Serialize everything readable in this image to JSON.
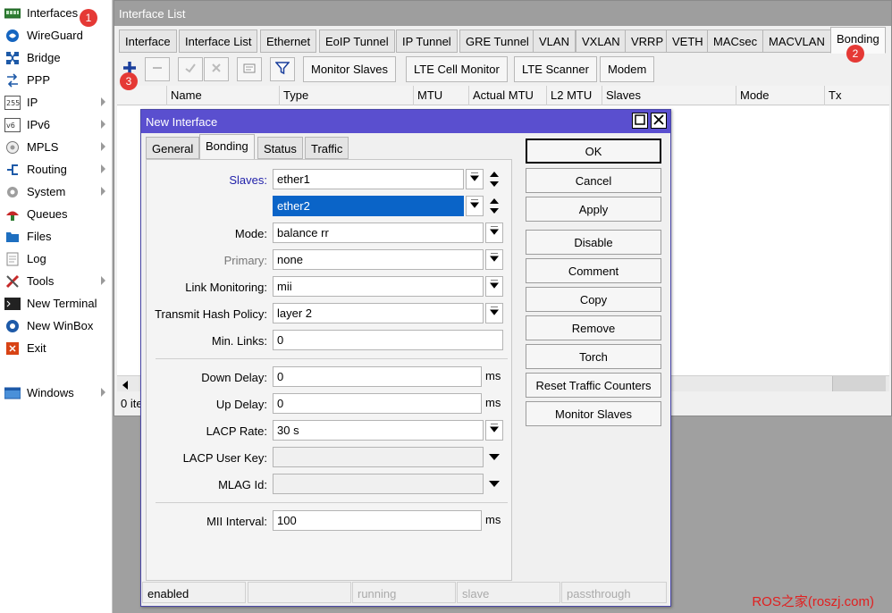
{
  "sidebar": {
    "items": [
      {
        "label": "Interfaces",
        "icon": "interfaces-icon",
        "submenu": false
      },
      {
        "label": "WireGuard",
        "icon": "wireguard-icon",
        "submenu": false
      },
      {
        "label": "Bridge",
        "icon": "bridge-icon",
        "submenu": false
      },
      {
        "label": "PPP",
        "icon": "ppp-icon",
        "submenu": false
      },
      {
        "label": "IP",
        "icon": "ip-icon",
        "submenu": true
      },
      {
        "label": "IPv6",
        "icon": "ipv6-icon",
        "submenu": true
      },
      {
        "label": "MPLS",
        "icon": "mpls-icon",
        "submenu": true
      },
      {
        "label": "Routing",
        "icon": "routing-icon",
        "submenu": true
      },
      {
        "label": "System",
        "icon": "system-icon",
        "submenu": true
      },
      {
        "label": "Queues",
        "icon": "queues-icon",
        "submenu": false
      },
      {
        "label": "Files",
        "icon": "files-icon",
        "submenu": false
      },
      {
        "label": "Log",
        "icon": "log-icon",
        "submenu": false
      },
      {
        "label": "Tools",
        "icon": "tools-icon",
        "submenu": true
      },
      {
        "label": "New Terminal",
        "icon": "terminal-icon",
        "submenu": false
      },
      {
        "label": "New WinBox",
        "icon": "winbox-icon",
        "submenu": false
      },
      {
        "label": "Exit",
        "icon": "exit-icon",
        "submenu": false
      },
      {
        "label": "Windows",
        "icon": "windows-icon",
        "submenu": true
      }
    ]
  },
  "badges": [
    "1",
    "2",
    "3"
  ],
  "main": {
    "title": "Interface List",
    "tabs": [
      "Interface",
      "Interface List",
      "Ethernet",
      "EoIP Tunnel",
      "IP Tunnel",
      "GRE Tunnel",
      "VLAN",
      "VXLAN",
      "VRRP",
      "VETH",
      "MACsec",
      "MACVLAN",
      "Bonding"
    ],
    "active_tab": "Bonding",
    "toolbar": {
      "icons": [
        "add-icon",
        "remove-icon",
        "enable-icon",
        "disable-icon",
        "comment-icon",
        "filter-icon"
      ],
      "buttons": [
        "Monitor Slaves",
        "LTE Cell Monitor",
        "LTE Scanner",
        "Modem"
      ]
    },
    "columns": [
      "Name",
      "Type",
      "MTU",
      "Actual MTU",
      "L2 MTU",
      "Slaves",
      "Mode",
      "Tx"
    ],
    "status": "0 ite"
  },
  "dialog": {
    "title": "New Interface",
    "tabs": [
      "General",
      "Bonding",
      "Status",
      "Traffic"
    ],
    "active_tab": "Bonding",
    "fields": {
      "slaves_label": "Slaves:",
      "slave1": "ether1",
      "slave2": "ether2",
      "mode_label": "Mode:",
      "mode": "balance rr",
      "primary_label": "Primary:",
      "primary": "none",
      "link_monitoring_label": "Link Monitoring:",
      "link_monitoring": "mii",
      "hash_policy_label": "Transmit Hash Policy:",
      "hash_policy": "layer 2",
      "min_links_label": "Min. Links:",
      "min_links": "0",
      "down_delay_label": "Down Delay:",
      "down_delay": "0",
      "up_delay_label": "Up Delay:",
      "up_delay": "0",
      "lacp_rate_label": "LACP Rate:",
      "lacp_rate": "30 s",
      "lacp_user_key_label": "LACP User Key:",
      "lacp_user_key": "",
      "mlag_id_label": "MLAG Id:",
      "mlag_id": "",
      "mii_interval_label": "MII Interval:",
      "mii_interval": "100",
      "unit_ms": "ms"
    },
    "buttons": [
      "OK",
      "Cancel",
      "Apply",
      "Disable",
      "Comment",
      "Copy",
      "Remove",
      "Torch",
      "Reset Traffic Counters",
      "Monitor Slaves"
    ],
    "status": [
      "enabled",
      "",
      "running",
      "slave",
      "passthrough"
    ]
  },
  "watermark": "ROS之家(roszj.com)",
  "colors": {
    "accent": "#5a4fcf",
    "selection": "#0a64c8",
    "badge": "#e53935",
    "title_grey": "#9e9e9e"
  }
}
